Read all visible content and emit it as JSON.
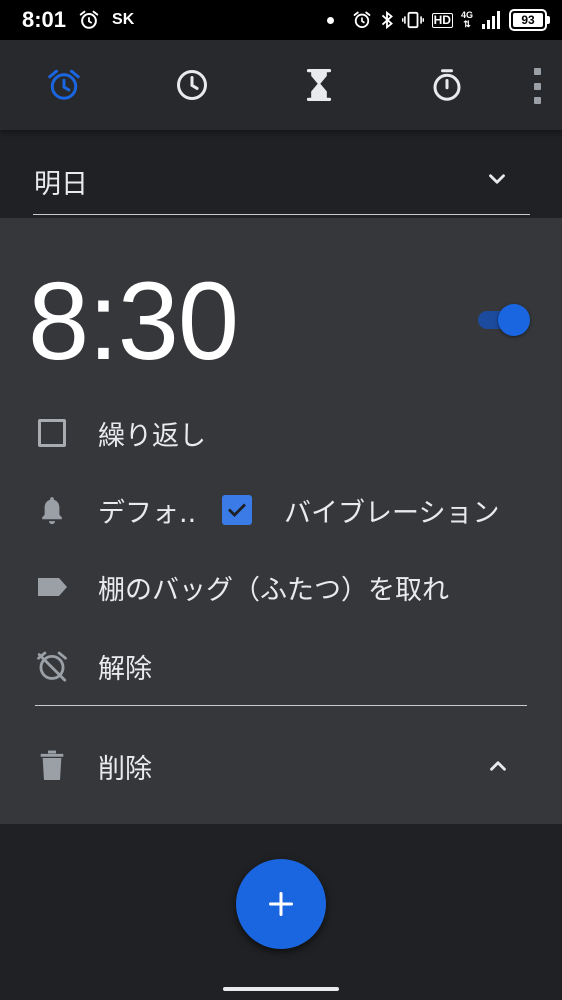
{
  "status_bar": {
    "time": "8:01",
    "carrier": "SK",
    "network": "4G",
    "hd": "HD",
    "battery": "93"
  },
  "tabs": [
    {
      "icon": "alarm-icon",
      "active": true
    },
    {
      "icon": "clock-icon",
      "active": false
    },
    {
      "icon": "hourglass-icon",
      "active": false
    },
    {
      "icon": "stopwatch-icon",
      "active": false
    }
  ],
  "day_header": {
    "label": "明日"
  },
  "alarm": {
    "time": "8:30",
    "enabled": true,
    "repeat_label": "繰り返し",
    "ringtone_label": "デフォ..",
    "vibration_label": "バイブレーション",
    "vibration_checked": true,
    "tag_label": "棚のバッグ（ふたつ）を取れ",
    "dismiss_label": "解除",
    "delete_label": "削除"
  },
  "colors": {
    "accent": "#1a66e0",
    "background": "#202124",
    "card": "#35373b",
    "tabbar": "#28292c"
  }
}
